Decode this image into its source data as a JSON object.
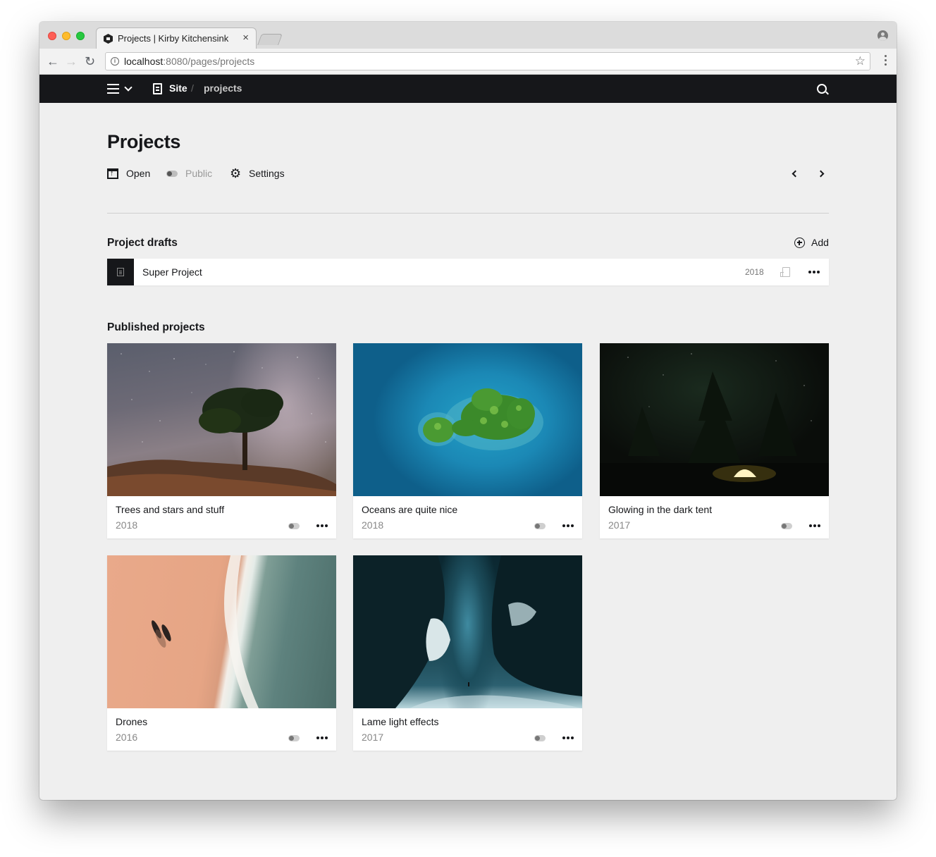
{
  "browser": {
    "tab_title": "Projects | Kirby Kitchensink",
    "tab_close": "×",
    "url_host": "localhost",
    "url_path": ":8080/pages/projects"
  },
  "topbar": {
    "crumb_site": "Site",
    "crumb_separator": "/",
    "crumb_current": "projects"
  },
  "page": {
    "title": "Projects",
    "actions": {
      "open": "Open",
      "public": "Public",
      "settings": "Settings"
    }
  },
  "drafts": {
    "heading": "Project drafts",
    "add_label": "Add",
    "items": [
      {
        "title": "Super Project",
        "year": "2018"
      }
    ]
  },
  "published": {
    "heading": "Published projects",
    "items": [
      {
        "title": "Trees and stars and stuff",
        "year": "2018",
        "image": "milky-way-tree"
      },
      {
        "title": "Oceans are quite nice",
        "year": "2018",
        "image": "aerial-island"
      },
      {
        "title": "Glowing in the dark tent",
        "year": "2017",
        "image": "night-tent"
      },
      {
        "title": "Drones",
        "year": "2016",
        "image": "beach-aerial"
      },
      {
        "title": "Lame light effects",
        "year": "2017",
        "image": "ice-cave-light"
      }
    ]
  },
  "colors": {
    "topbar_bg": "#16171a",
    "page_bg": "#efefef",
    "card_bg": "#ffffff",
    "text": "#16171a",
    "muted": "#888888"
  }
}
